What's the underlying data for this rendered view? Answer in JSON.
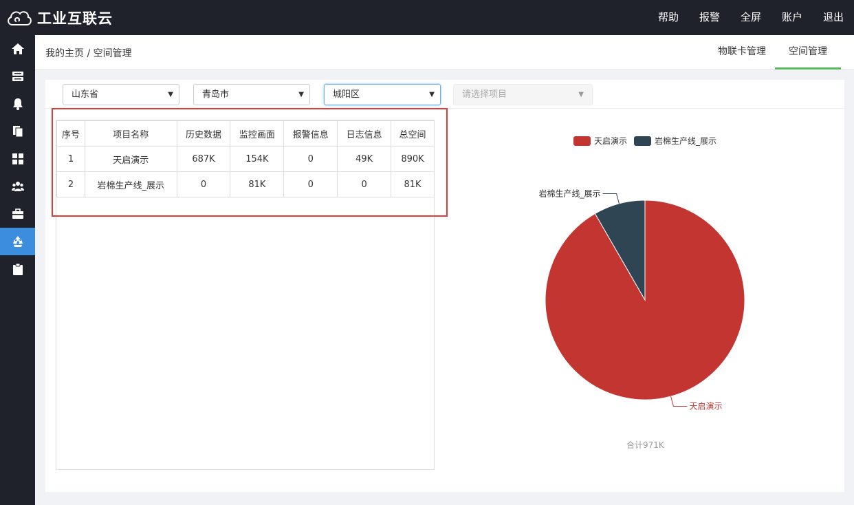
{
  "app": {
    "title": "工业互联云"
  },
  "topnav": [
    "帮助",
    "报警",
    "全屏",
    "账户",
    "退出"
  ],
  "sidebar": [
    "home-icon",
    "server-icon",
    "bell-icon",
    "copy-icon",
    "dashboard-icon",
    "users-icon",
    "briefcase-icon",
    "recycle-icon",
    "clipboard-icon"
  ],
  "breadcrumb": "我的主页 / 空间管理",
  "tabs": [
    "物联卡管理",
    "空间管理"
  ],
  "filters": {
    "province": "山东省",
    "city": "青岛市",
    "district": "城阳区",
    "project_placeholder": "请选择项目"
  },
  "table": {
    "headers": [
      "序号",
      "项目名称",
      "历史数据",
      "监控画面",
      "报警信息",
      "日志信息",
      "总空间"
    ],
    "rows": [
      [
        "1",
        "天启演示",
        "687K",
        "154K",
        "0",
        "49K",
        "890K"
      ],
      [
        "2",
        "岩棉生产线_展示",
        "0",
        "81K",
        "0",
        "0",
        "81K"
      ]
    ]
  },
  "chart_data": {
    "type": "pie",
    "series": [
      {
        "name": "天启演示",
        "value": 890,
        "color": "#c23531"
      },
      {
        "name": "岩棉生产线_展示",
        "value": 81,
        "color": "#2f4554"
      }
    ],
    "legend_position": "top",
    "total_label": "合计971K"
  },
  "colors": {
    "topbar": "#1f222b",
    "accent": "#3c8dde",
    "tab_active": "#5cb85c",
    "highlight": "#e53935"
  }
}
